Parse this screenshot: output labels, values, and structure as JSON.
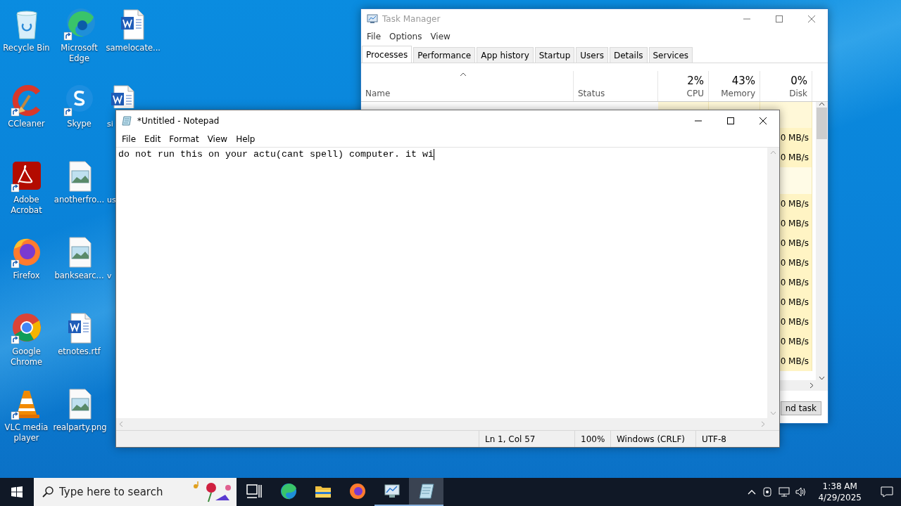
{
  "desktop": {
    "icons": [
      {
        "label": "Recycle Bin",
        "kind": "bin",
        "shortcut": false
      },
      {
        "label": "CCleaner",
        "kind": "ccleaner",
        "shortcut": true
      },
      {
        "label": "Adobe Acrobat",
        "kind": "acrobat",
        "shortcut": true
      },
      {
        "label": "Firefox",
        "kind": "firefox",
        "shortcut": true
      },
      {
        "label": "Google Chrome",
        "kind": "chrome",
        "shortcut": true
      },
      {
        "label": "VLC media player",
        "kind": "vlc",
        "shortcut": true
      },
      {
        "label": "Microsoft Edge",
        "kind": "edge",
        "shortcut": true
      },
      {
        "label": "Skype",
        "kind": "skype",
        "shortcut": true
      },
      {
        "label": "anotherfro...",
        "kind": "image",
        "shortcut": false
      },
      {
        "label": "banksearc...",
        "kind": "image",
        "shortcut": false
      },
      {
        "label": "etnotes.rtf",
        "kind": "word",
        "shortcut": false
      },
      {
        "label": "realparty.png",
        "kind": "image",
        "shortcut": false
      },
      {
        "label": "samelocate...",
        "kind": "word",
        "shortcut": false
      },
      {
        "label": "si",
        "kind": "word",
        "shortcut": false,
        "cut": true
      },
      {
        "label": "us",
        "cut": true
      },
      {
        "label": "v",
        "cut": true
      }
    ]
  },
  "task_manager": {
    "title": "Task Manager",
    "menu": [
      "File",
      "Options",
      "View"
    ],
    "tabs": [
      {
        "label": "Processes",
        "selected": true
      },
      {
        "label": "Performance",
        "selected": false
      },
      {
        "label": "App history",
        "selected": false
      },
      {
        "label": "Startup",
        "selected": false
      },
      {
        "label": "Users",
        "selected": false
      },
      {
        "label": "Details",
        "selected": false
      },
      {
        "label": "Services",
        "selected": false
      }
    ],
    "columns": [
      {
        "label": "Name"
      },
      {
        "label": "Status"
      },
      {
        "label": "CPU",
        "total": "2%"
      },
      {
        "label": "Memory",
        "total": "43%"
      },
      {
        "label": "Disk",
        "total": "0%"
      }
    ],
    "rows": [
      {
        "kind": "blank"
      },
      {
        "kind": "process",
        "disk": "0 MB/s"
      },
      {
        "kind": "process",
        "disk": "0 MB/s"
      },
      {
        "kind": "group"
      },
      {
        "kind": "process",
        "disk": "0 MB/s"
      },
      {
        "kind": "process",
        "disk": "0 MB/s"
      },
      {
        "kind": "process",
        "disk": "0 MB/s"
      },
      {
        "kind": "process",
        "disk": "0 MB/s"
      },
      {
        "kind": "process",
        "disk": "0 MB/s"
      },
      {
        "kind": "process",
        "disk": "0 MB/s"
      },
      {
        "kind": "process",
        "disk": "0 MB/s"
      },
      {
        "kind": "process",
        "disk": "0 MB/s"
      },
      {
        "kind": "process",
        "disk": "0 MB/s"
      }
    ],
    "end_task": "nd task"
  },
  "notepad": {
    "title": "*Untitled - Notepad",
    "menu": [
      "File",
      "Edit",
      "Format",
      "View",
      "Help"
    ],
    "text": "do not run this on your actu(cant spell) computer. it wi",
    "status": [
      "Ln 1, Col 57",
      "100%",
      "Windows (CRLF)",
      "UTF-8"
    ]
  },
  "taskbar": {
    "search": {
      "placeholder": "Type here to search"
    },
    "apps": [
      {
        "kind": "taskview",
        "running": false,
        "active": false
      },
      {
        "kind": "edge",
        "running": false,
        "active": false
      },
      {
        "kind": "folder",
        "running": false,
        "active": false
      },
      {
        "kind": "firefox",
        "running": false,
        "active": false
      },
      {
        "kind": "taskmanager",
        "running": true,
        "active": false
      },
      {
        "kind": "notepad",
        "running": true,
        "active": true
      }
    ],
    "clock": {
      "time": "1:38 AM",
      "date": "4/29/2025"
    }
  }
}
